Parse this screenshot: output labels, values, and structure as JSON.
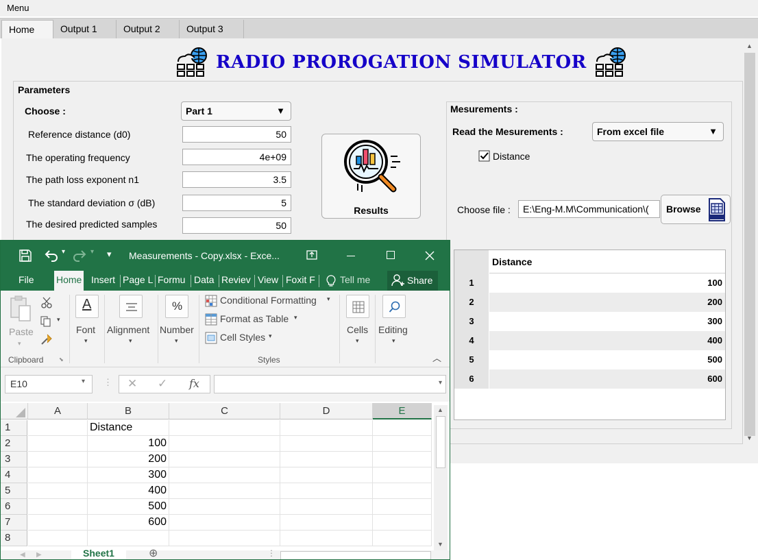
{
  "app": {
    "menu_label": "Menu",
    "tabs": [
      "Home",
      "Output 1",
      "Output 2",
      "Output 3"
    ],
    "title": "RADIO PROROGATION SIMULATOR",
    "parameters": {
      "group_label": "Parameters",
      "choose_label": "Choose :",
      "choose_value": "Part 1",
      "fields": [
        {
          "label": "Reference distance (d0)",
          "value": "50"
        },
        {
          "label": "The operating frequency",
          "value": "4e+09"
        },
        {
          "label": "The path loss exponent n1",
          "value": "3.5"
        },
        {
          "label": "The standard deviation σ (dB)",
          "value": "5"
        },
        {
          "label": "The desired predicted samples",
          "value": "50"
        }
      ]
    },
    "results_label": "Results",
    "measurements": {
      "group_label": "Mesurements :",
      "read_label": "Read the Mesurements :",
      "read_value": "From excel file",
      "distance_checkbox": "Distance",
      "distance_checked": true,
      "choose_file_label": "Choose file :",
      "file_path": "E:\\Eng-M.M\\Communication\\(",
      "browse_label": "Browse",
      "table_header": "Distance",
      "rows": [
        {
          "n": "1",
          "v": "100"
        },
        {
          "n": "2",
          "v": "200"
        },
        {
          "n": "3",
          "v": "300"
        },
        {
          "n": "4",
          "v": "400"
        },
        {
          "n": "5",
          "v": "500"
        },
        {
          "n": "6",
          "v": "600"
        }
      ]
    }
  },
  "excel": {
    "window_title": "Measurements - Copy.xlsx - Exce...",
    "ribbon_tabs": [
      "File",
      "Home",
      "Insert",
      "Page L",
      "Formu",
      "Data",
      "Reviev",
      "View",
      "Foxit F"
    ],
    "tell_me": "Tell me",
    "share": "Share",
    "groups": {
      "paste": "Paste",
      "clipboard": "Clipboard",
      "font": "Font",
      "alignment": "Alignment",
      "number": "Number",
      "conditional_formatting": "Conditional Formatting",
      "format_as_table": "Format as Table",
      "cell_styles": "Cell Styles",
      "styles": "Styles",
      "cells": "Cells",
      "editing": "Editing"
    },
    "name_box": "E10",
    "fx": "fx",
    "columns": [
      "A",
      "B",
      "C",
      "D",
      "E"
    ],
    "rows": [
      "1",
      "2",
      "3",
      "4",
      "5",
      "6",
      "7",
      "8"
    ],
    "b_values": [
      "Distance",
      "100",
      "200",
      "300",
      "400",
      "500",
      "600",
      ""
    ],
    "sheet_tab": "Sheet1"
  },
  "colors": {
    "title_blue": "#1500c8",
    "excel_green": "#217346"
  }
}
